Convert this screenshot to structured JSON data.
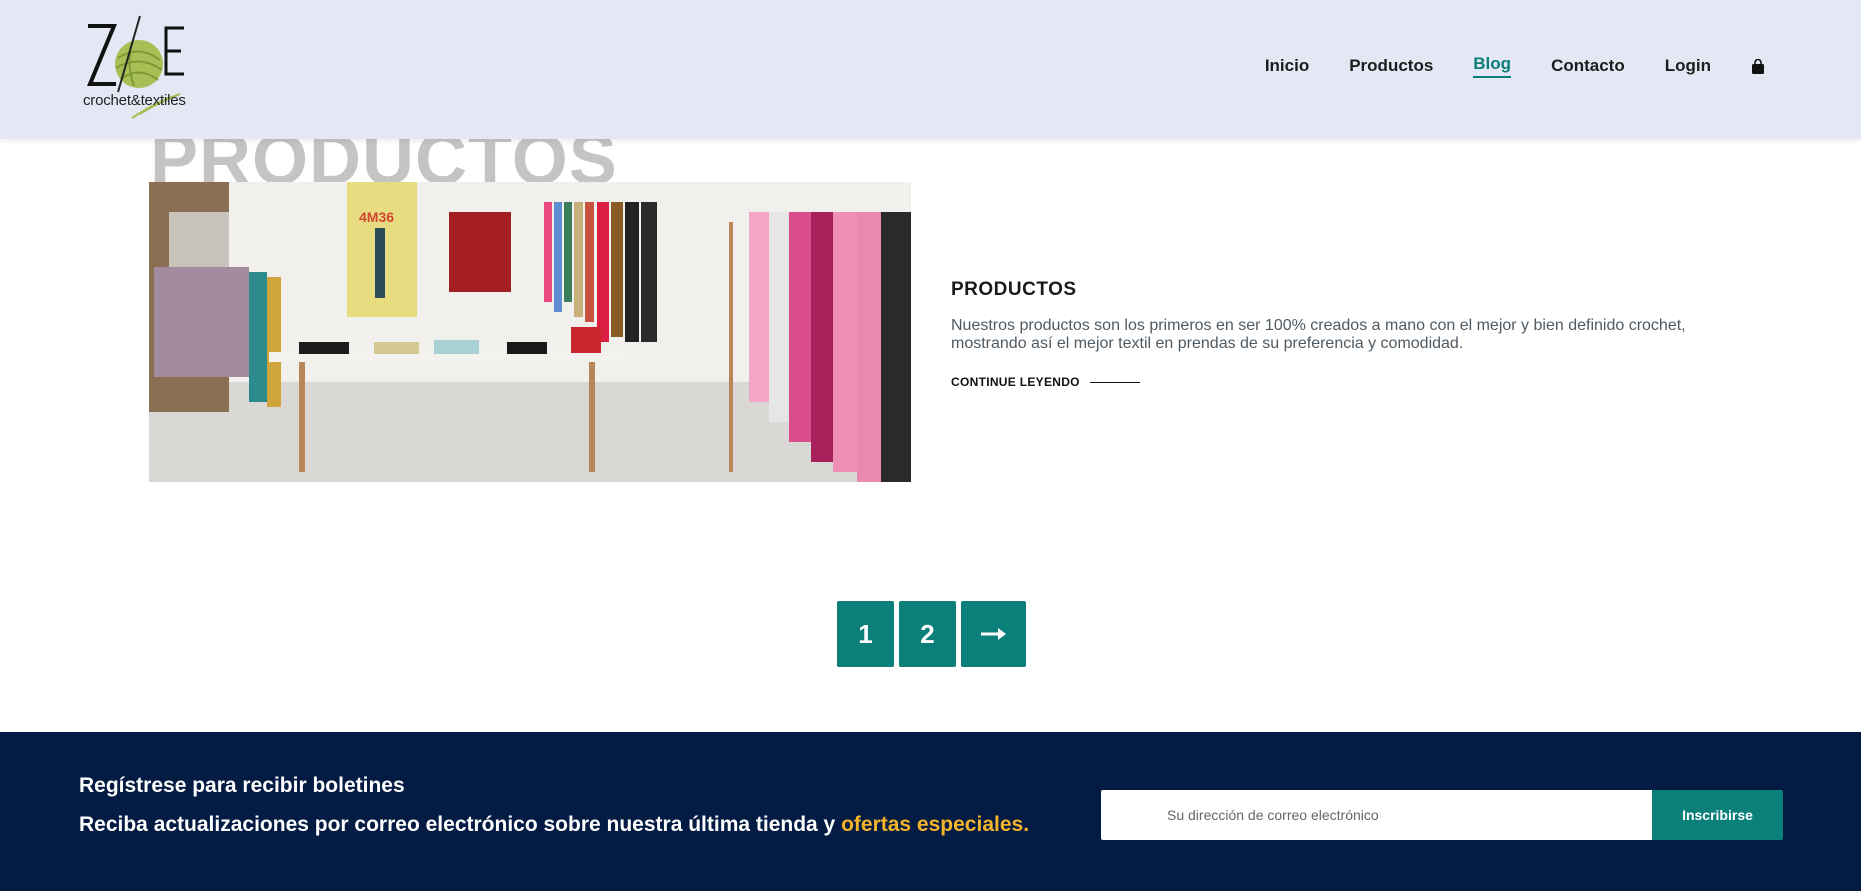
{
  "header": {
    "logo_text": "crochet&textiles",
    "nav": [
      {
        "label": "Inicio"
      },
      {
        "label": "Productos"
      },
      {
        "label": "Blog"
      },
      {
        "label": "Contacto"
      },
      {
        "label": "Login"
      }
    ],
    "active_nav": "Blog",
    "cart_icon": "shopping-bag-icon"
  },
  "main": {
    "ghost_title": "PRODUCTOS",
    "post": {
      "title": "PRODUCTOS",
      "excerpt": "Nuestros productos son los primeros en ser 100% creados a mano con el mejor y bien definido crochet, mostrando así el mejor textil en prendas de su preferencia y comodidad.",
      "read_more": "CONTINUE LEYENDO",
      "image_sign": "4M36"
    }
  },
  "pagination": {
    "pages": [
      "1",
      "2"
    ],
    "next_icon": "arrow-right-icon"
  },
  "footer": {
    "heading": "Regístrese para recibir boletines",
    "text_prefix": "Reciba actualizaciones por correo electrónico sobre nuestra última tienda y ",
    "text_highlight": "ofertas especiales.",
    "email_placeholder": "Su dirección de correo electrónico",
    "subscribe_label": "Inscribirse"
  },
  "colors": {
    "header_bg": "#e3e8f4",
    "accent": "#0b7f7a",
    "footer_bg": "#041c43",
    "highlight": "#f4b42a"
  }
}
